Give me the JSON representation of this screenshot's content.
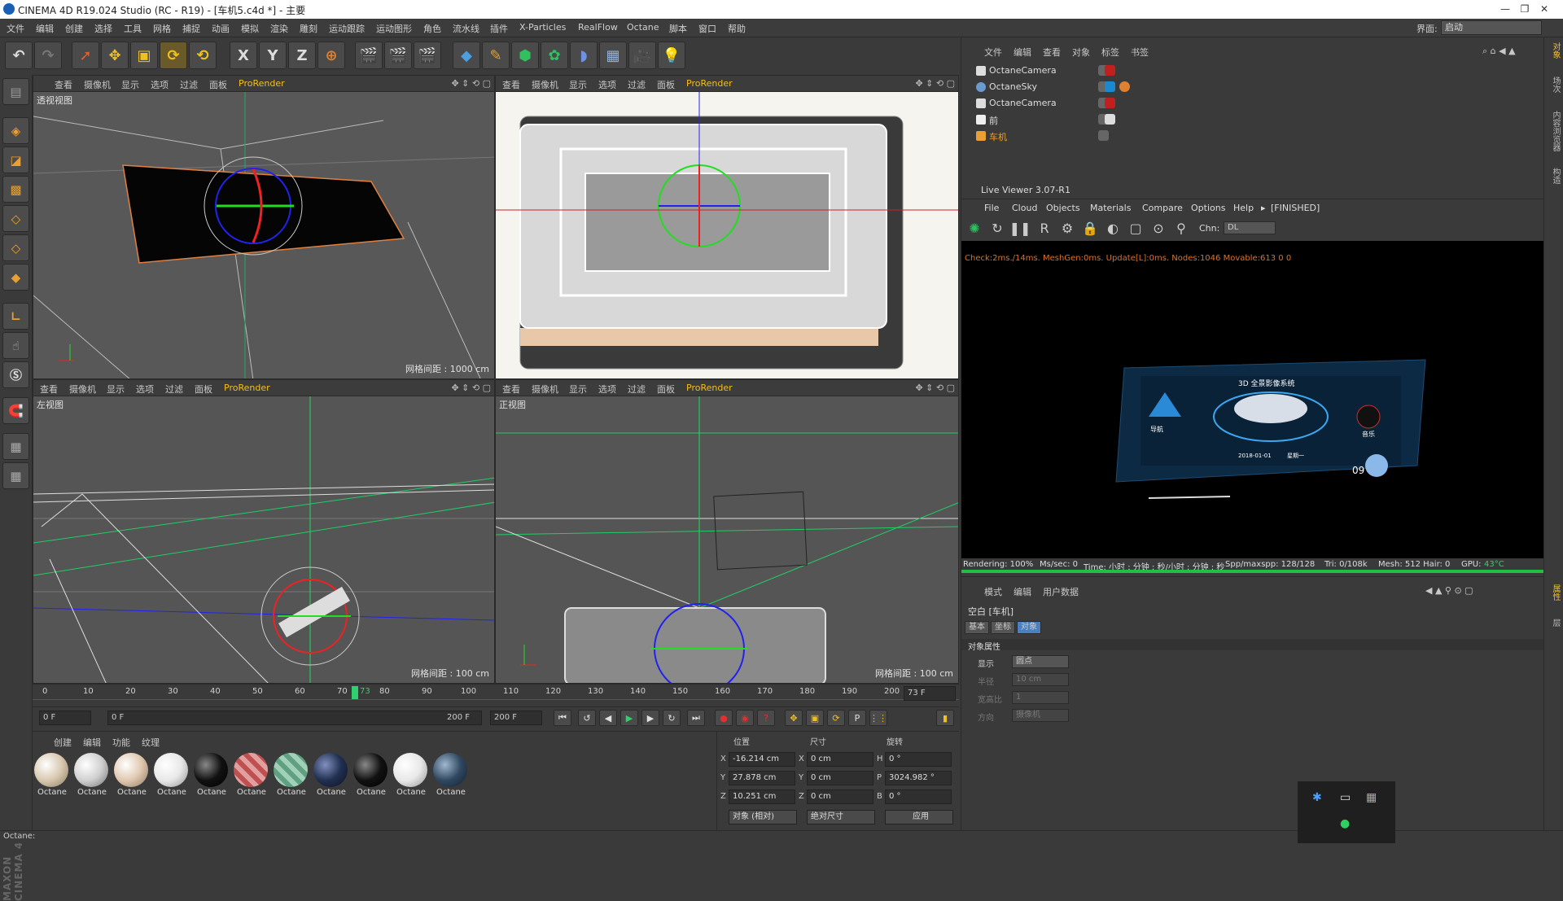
{
  "window": {
    "title": "CINEMA 4D R19.024 Studio (RC - R19) - [车机5.c4d *] - 主要",
    "min": "—",
    "restore": "❐",
    "close": "✕"
  },
  "menu": [
    "文件",
    "编辑",
    "创建",
    "选择",
    "工具",
    "网格",
    "捕捉",
    "动画",
    "模拟",
    "渲染",
    "雕刻",
    "运动跟踪",
    "运动图形",
    "角色",
    "流水线",
    "插件",
    "X-Particles",
    "RealFlow",
    "Octane",
    "脚本",
    "窗口",
    "帮助"
  ],
  "layout": {
    "label": "界面:",
    "value": "启动"
  },
  "viewports": [
    {
      "label": "透视视图",
      "grid": ""
    },
    {
      "label": "",
      "grid": ""
    },
    {
      "label": "左视图",
      "grid": "网格间距 : 100 cm"
    },
    {
      "label": "正视图",
      "grid": "网格间距 : 100 cm"
    }
  ],
  "vp_grid_top_left": "网格间距 : 1000 cm",
  "vp_menu": [
    "查看",
    "摄像机",
    "显示",
    "选项",
    "过滤",
    "面板",
    "ProRender"
  ],
  "timeline": {
    "ticks": [
      "0",
      "10",
      "20",
      "30",
      "40",
      "50",
      "60",
      "70",
      "73",
      "80",
      "90",
      "100",
      "110",
      "120",
      "130",
      "140",
      "150",
      "160",
      "170",
      "180",
      "190",
      "200"
    ],
    "current": "73 F"
  },
  "transport": {
    "start": "0 F",
    "range_start": "0 F",
    "range_end": "200 F",
    "end": "200 F"
  },
  "materials": {
    "menu": [
      "创建",
      "编辑",
      "功能",
      "纹理"
    ],
    "items": [
      "Octane",
      "Octane",
      "Octane",
      "Octane",
      "Octane",
      "Octane",
      "Octane",
      "Octane",
      "Octane",
      "Octane",
      "Octane"
    ]
  },
  "coords": {
    "headers": [
      "位置",
      "尺寸",
      "旋转"
    ],
    "rows": [
      {
        "axis": "X",
        "pos": "-16.214 cm",
        "size_axis": "X",
        "size": "0 cm",
        "rot_axis": "H",
        "rot": "0 °"
      },
      {
        "axis": "Y",
        "pos": "27.878 cm",
        "size_axis": "Y",
        "size": "0 cm",
        "rot_axis": "P",
        "rot": "3024.982 °"
      },
      {
        "axis": "Z",
        "pos": "10.251 cm",
        "size_axis": "Z",
        "size": "0 cm",
        "rot_axis": "B",
        "rot": "0 °"
      }
    ],
    "mode": "对象 (相对)",
    "size_mode": "绝对尺寸",
    "apply": "应用"
  },
  "status": "Octane:",
  "objects": {
    "menu": [
      "文件",
      "编辑",
      "查看",
      "对象",
      "标签",
      "书签"
    ],
    "rows": [
      {
        "name": "OctaneCamera",
        "color": "#dddddd"
      },
      {
        "name": "OctaneSky",
        "color": "#dddddd"
      },
      {
        "name": "OctaneCamera",
        "color": "#dddddd"
      },
      {
        "name": "前",
        "color": "#dddddd"
      },
      {
        "name": "车机",
        "color": "#e8a030"
      }
    ]
  },
  "liveviewer": {
    "title": "Live Viewer 3.07-R1",
    "menu": [
      "File",
      "Cloud",
      "Objects",
      "Materials",
      "Compare",
      "Options",
      "Help",
      "▸",
      "[FINISHED]"
    ],
    "chn_label": "Chn:",
    "chn_value": "DL",
    "info": "Check:2ms./14ms. MeshGen:0ms. Update[L]:0ms. Nodes:1046 Movable:613  0 0",
    "status": {
      "rendering": "Rendering: 100%",
      "ms": "Ms/sec: 0",
      "time": "Time: 小时 : 分钟 : 秒/小时 : 分钟 : 秒",
      "spp": "Spp/maxspp: 128/128",
      "tri": "Tri: 0/108k",
      "mesh": "Mesh: 512  Hair: 0",
      "gpu": "GPU:",
      "temp": "43°C"
    },
    "progress": 1.0,
    "screen": {
      "title": "3D 全景影像系统",
      "nav": "导航",
      "music": "音乐",
      "date": "2018-01-01",
      "weekday": "星期一",
      "num": "09"
    }
  },
  "attributes": {
    "menu": [
      "模式",
      "编辑",
      "用户数据"
    ],
    "object": "空白 [车机]",
    "tabs": [
      "基本",
      "坐标",
      "对象"
    ],
    "section": "对象属性",
    "rows": [
      {
        "label": "显示",
        "value": "圆点"
      },
      {
        "label": "半径",
        "value": "10 cm"
      },
      {
        "label": "宽高比",
        "value": "1"
      },
      {
        "label": "方向",
        "value": "摄像机"
      }
    ]
  },
  "right_tabs": [
    "对象",
    "场次",
    "内容浏览器",
    "构造"
  ],
  "right_tabs_lower": [
    "属性",
    "层"
  ],
  "colors": {
    "accent": "#f0c020",
    "orange": "#e07020",
    "green": "#00c060"
  }
}
